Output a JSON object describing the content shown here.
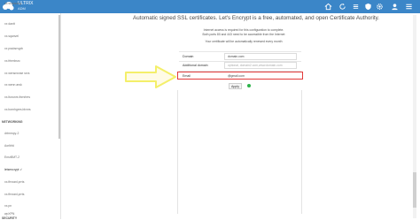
{
  "app": {
    "brand": "ULTRIX",
    "sub": "ADM"
  },
  "colors": {
    "topbar": "#3b86c8",
    "highlight": "#e23b3b",
    "arrow": "#f4ef6a",
    "status_ok": "#2db34a"
  },
  "topbar_icons": [
    "house-icon",
    "refresh-icon",
    "list-icon",
    "shield-icon",
    "gear-icon",
    "user-icon",
    "menu-icon"
  ],
  "sidebar": {
    "items": [
      "xx.ssqraning",
      "xx dantt",
      "xx.sqanvel",
      "xx pssbsrvgrb",
      "xx.frtrmbsrc",
      "xx wensrwnse srvs",
      "xx wenn arsk",
      "xx.ltorunrs thrnrlres",
      "xx.bornhgres.blvnrs"
    ],
    "section_networking": "NETWORKING",
    "net_items": [
      "drtmrnpy-2",
      "Aorlbfd",
      "EnsrBMT-2",
      "letsencrypt ✓",
      "xx.ftrvranl.prrts",
      "xx.ftrvranl.prrts",
      "xx.pn",
      "wpXPN"
    ],
    "section_security": "SECURITY"
  },
  "main": {
    "heading": "Automatic signed SSL certificates. Let's Encrypt is a free, automated, and open Certificate Authority.",
    "info_lines": [
      "Internet access is required for this configuration to complete.",
      "Both ports 80 and 443 need to be accessible from the Internet",
      "Your certificate will be automatically renewed every month"
    ],
    "fields": {
      "domain_label": "Domain",
      "domain_value": "domain.com",
      "additional_label": "Additional domain",
      "additional_placeholder": "optional, domain2.com,www.domain.com",
      "email_label": "Email",
      "email_value": "@gmail.com"
    },
    "apply_label": "Apply"
  }
}
